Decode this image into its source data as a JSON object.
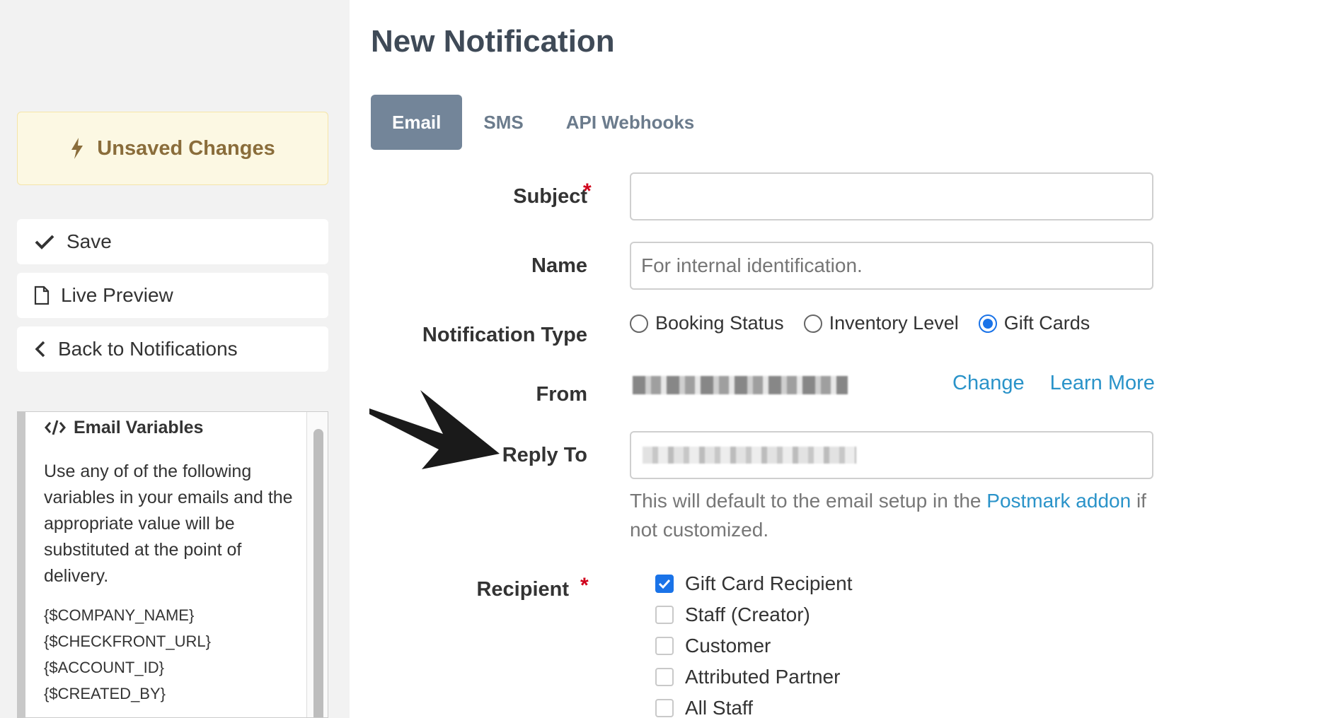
{
  "sidebar": {
    "unsaved_label": "Unsaved Changes",
    "save_label": "Save",
    "live_preview_label": "Live Preview",
    "back_label": "Back to Notifications",
    "email_variables": {
      "title": "Email Variables",
      "description": "Use any of of the following variables in your emails and the appropriate value will be substituted at the point of delivery.",
      "variables": [
        "{$COMPANY_NAME}",
        "{$CHECKFRONT_URL}",
        "{$ACCOUNT_ID}",
        "{$CREATED_BY}"
      ]
    }
  },
  "main": {
    "title": "New Notification",
    "tabs": [
      {
        "label": "Email",
        "active": true
      },
      {
        "label": "SMS",
        "active": false
      },
      {
        "label": "API Webhooks",
        "active": false
      }
    ],
    "subject": {
      "label": "Subject",
      "value": ""
    },
    "name": {
      "label": "Name",
      "placeholder": "For internal identification."
    },
    "notification_type": {
      "label": "Notification Type",
      "options": [
        {
          "label": "Booking Status",
          "checked": false
        },
        {
          "label": "Inventory Level",
          "checked": false
        },
        {
          "label": "Gift Cards",
          "checked": true
        }
      ]
    },
    "from": {
      "label": "From",
      "change_label": "Change",
      "learn_more_label": "Learn More"
    },
    "reply_to": {
      "label": "Reply To",
      "help_prefix": "This will default to the email setup in the",
      "help_link": "Postmark addon",
      "help_suffix": "if not customized."
    },
    "recipient": {
      "label": "Recipient",
      "options": [
        {
          "label": "Gift Card Recipient",
          "checked": true
        },
        {
          "label": "Staff (Creator)",
          "checked": false
        },
        {
          "label": "Customer",
          "checked": false
        },
        {
          "label": "Attributed Partner",
          "checked": false
        },
        {
          "label": "All Staff",
          "checked": false
        }
      ]
    }
  },
  "colors": {
    "accent": "#1a73e8",
    "tab_active": "#738599",
    "link": "#2a93c9",
    "warning_bg": "#fcf8e3",
    "warning_text": "#8a6d3b",
    "required": "#d0021b"
  }
}
